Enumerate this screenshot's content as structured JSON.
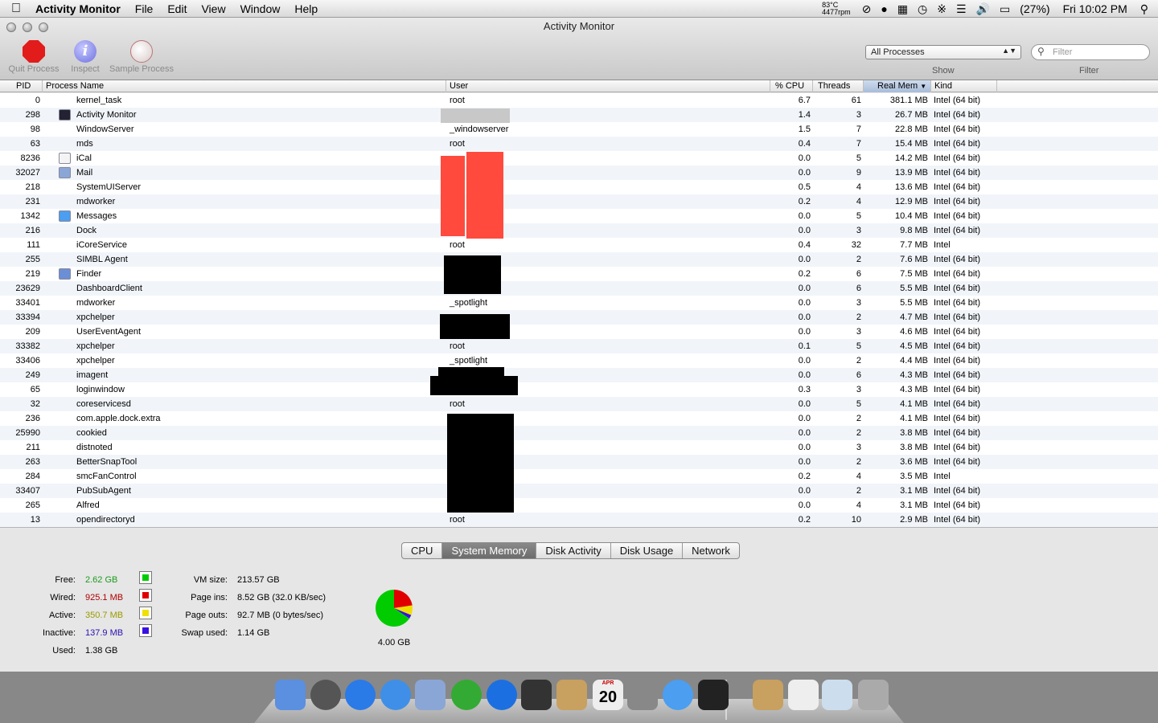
{
  "menubar": {
    "app_name": "Activity Monitor",
    "menus": [
      "File",
      "Edit",
      "View",
      "Window",
      "Help"
    ],
    "temp": "83°C",
    "rpm": "4477rpm",
    "battery": "(27%)",
    "clock": "Fri 10:02 PM"
  },
  "window": {
    "title": "Activity Monitor"
  },
  "toolbar": {
    "quit_label": "Quit Process",
    "inspect_label": "Inspect",
    "inspect_glyph": "i",
    "sample_label": "Sample Process",
    "show_value": "All Processes",
    "show_label": "Show",
    "filter_placeholder": "Filter",
    "filter_label": "Filter"
  },
  "columns": {
    "pid": "PID",
    "name": "Process Name",
    "user": "User",
    "cpu": "% CPU",
    "threads": "Threads",
    "mem": "Real Mem",
    "kind": "Kind"
  },
  "processes": [
    {
      "pid": "0",
      "name": "kernel_task",
      "user": "root",
      "cpu": "6.7",
      "threads": "61",
      "mem": "381.1 MB",
      "kind": "Intel (64 bit)",
      "icon": ""
    },
    {
      "pid": "298",
      "name": "Activity Monitor",
      "user": "",
      "cpu": "1.4",
      "threads": "3",
      "mem": "26.7 MB",
      "kind": "Intel (64 bit)",
      "icon": "activity-monitor-icon"
    },
    {
      "pid": "98",
      "name": "WindowServer",
      "user": "_windowserver",
      "cpu": "1.5",
      "threads": "7",
      "mem": "22.8 MB",
      "kind": "Intel (64 bit)",
      "icon": ""
    },
    {
      "pid": "63",
      "name": "mds",
      "user": "root",
      "cpu": "0.4",
      "threads": "7",
      "mem": "15.4 MB",
      "kind": "Intel (64 bit)",
      "icon": ""
    },
    {
      "pid": "8236",
      "name": "iCal",
      "user": "",
      "cpu": "0.0",
      "threads": "5",
      "mem": "14.2 MB",
      "kind": "Intel (64 bit)",
      "icon": "ical-icon"
    },
    {
      "pid": "32027",
      "name": "Mail",
      "user": "",
      "cpu": "0.0",
      "threads": "9",
      "mem": "13.9 MB",
      "kind": "Intel (64 bit)",
      "icon": "mail-icon"
    },
    {
      "pid": "218",
      "name": "SystemUIServer",
      "user": "",
      "cpu": "0.5",
      "threads": "4",
      "mem": "13.6 MB",
      "kind": "Intel (64 bit)",
      "icon": ""
    },
    {
      "pid": "231",
      "name": "mdworker",
      "user": "",
      "cpu": "0.2",
      "threads": "4",
      "mem": "12.9 MB",
      "kind": "Intel (64 bit)",
      "icon": ""
    },
    {
      "pid": "1342",
      "name": "Messages",
      "user": "",
      "cpu": "0.0",
      "threads": "5",
      "mem": "10.4 MB",
      "kind": "Intel (64 bit)",
      "icon": "messages-icon"
    },
    {
      "pid": "216",
      "name": "Dock",
      "user": "",
      "cpu": "0.0",
      "threads": "3",
      "mem": "9.8 MB",
      "kind": "Intel (64 bit)",
      "icon": ""
    },
    {
      "pid": "111",
      "name": "iCoreService",
      "user": "root",
      "cpu": "0.4",
      "threads": "32",
      "mem": "7.7 MB",
      "kind": "Intel",
      "icon": ""
    },
    {
      "pid": "255",
      "name": "SIMBL Agent",
      "user": "",
      "cpu": "0.0",
      "threads": "2",
      "mem": "7.6 MB",
      "kind": "Intel (64 bit)",
      "icon": ""
    },
    {
      "pid": "219",
      "name": "Finder",
      "user": "",
      "cpu": "0.2",
      "threads": "6",
      "mem": "7.5 MB",
      "kind": "Intel (64 bit)",
      "icon": "finder-icon"
    },
    {
      "pid": "23629",
      "name": "DashboardClient",
      "user": "",
      "cpu": "0.0",
      "threads": "6",
      "mem": "5.5 MB",
      "kind": "Intel (64 bit)",
      "icon": ""
    },
    {
      "pid": "33401",
      "name": "mdworker",
      "user": "_spotlight",
      "cpu": "0.0",
      "threads": "3",
      "mem": "5.5 MB",
      "kind": "Intel (64 bit)",
      "icon": ""
    },
    {
      "pid": "33394",
      "name": "xpchelper",
      "user": "",
      "cpu": "0.0",
      "threads": "2",
      "mem": "4.7 MB",
      "kind": "Intel (64 bit)",
      "icon": ""
    },
    {
      "pid": "209",
      "name": "UserEventAgent",
      "user": "",
      "cpu": "0.0",
      "threads": "3",
      "mem": "4.6 MB",
      "kind": "Intel (64 bit)",
      "icon": ""
    },
    {
      "pid": "33382",
      "name": "xpchelper",
      "user": "root",
      "cpu": "0.1",
      "threads": "5",
      "mem": "4.5 MB",
      "kind": "Intel (64 bit)",
      "icon": ""
    },
    {
      "pid": "33406",
      "name": "xpchelper",
      "user": "_spotlight",
      "cpu": "0.0",
      "threads": "2",
      "mem": "4.4 MB",
      "kind": "Intel (64 bit)",
      "icon": ""
    },
    {
      "pid": "249",
      "name": "imagent",
      "user": "",
      "cpu": "0.0",
      "threads": "6",
      "mem": "4.3 MB",
      "kind": "Intel (64 bit)",
      "icon": ""
    },
    {
      "pid": "65",
      "name": "loginwindow",
      "user": "",
      "cpu": "0.3",
      "threads": "3",
      "mem": "4.3 MB",
      "kind": "Intel (64 bit)",
      "icon": ""
    },
    {
      "pid": "32",
      "name": "coreservicesd",
      "user": "root",
      "cpu": "0.0",
      "threads": "5",
      "mem": "4.1 MB",
      "kind": "Intel (64 bit)",
      "icon": ""
    },
    {
      "pid": "236",
      "name": "com.apple.dock.extra",
      "user": "",
      "cpu": "0.0",
      "threads": "2",
      "mem": "4.1 MB",
      "kind": "Intel (64 bit)",
      "icon": ""
    },
    {
      "pid": "25990",
      "name": "cookied",
      "user": "",
      "cpu": "0.0",
      "threads": "2",
      "mem": "3.8 MB",
      "kind": "Intel (64 bit)",
      "icon": ""
    },
    {
      "pid": "211",
      "name": "distnoted",
      "user": "",
      "cpu": "0.0",
      "threads": "3",
      "mem": "3.8 MB",
      "kind": "Intel (64 bit)",
      "icon": ""
    },
    {
      "pid": "263",
      "name": "BetterSnapTool",
      "user": "",
      "cpu": "0.0",
      "threads": "2",
      "mem": "3.6 MB",
      "kind": "Intel (64 bit)",
      "icon": ""
    },
    {
      "pid": "284",
      "name": "smcFanControl",
      "user": "",
      "cpu": "0.2",
      "threads": "4",
      "mem": "3.5 MB",
      "kind": "Intel",
      "icon": ""
    },
    {
      "pid": "33407",
      "name": "PubSubAgent",
      "user": "",
      "cpu": "0.0",
      "threads": "2",
      "mem": "3.1 MB",
      "kind": "Intel (64 bit)",
      "icon": ""
    },
    {
      "pid": "265",
      "name": "Alfred",
      "user": "",
      "cpu": "0.0",
      "threads": "4",
      "mem": "3.1 MB",
      "kind": "Intel (64 bit)",
      "icon": ""
    },
    {
      "pid": "13",
      "name": "opendirectoryd",
      "user": "root",
      "cpu": "0.2",
      "threads": "10",
      "mem": "2.9 MB",
      "kind": "Intel (64 bit)",
      "icon": ""
    }
  ],
  "tabs": [
    "CPU",
    "System Memory",
    "Disk Activity",
    "Disk Usage",
    "Network"
  ],
  "active_tab": "System Memory",
  "memory": {
    "free_label": "Free:",
    "free": "2.62 GB",
    "free_color": "#00cc00",
    "wired_label": "Wired:",
    "wired": "925.1 MB",
    "wired_color": "#e00000",
    "active_label": "Active:",
    "active": "350.7 MB",
    "active_color": "#f0e000",
    "inactive_label": "Inactive:",
    "inactive": "137.9 MB",
    "inactive_color": "#3a10e0",
    "used_label": "Used:",
    "used": "1.38 GB",
    "vm_label": "VM size:",
    "vm": "213.57 GB",
    "pageins_label": "Page ins:",
    "pageins": "8.52 GB (32.0 KB/sec)",
    "pageouts_label": "Page outs:",
    "pageouts": "92.7 MB (0 bytes/sec)",
    "swap_label": "Swap used:",
    "swap": "1.14 GB",
    "total": "4.00 GB"
  },
  "dock": [
    "finder-icon",
    "launchpad-icon",
    "app-store-icon",
    "safari-icon",
    "mail-icon",
    "spotify-icon",
    "itunes-icon",
    "facetime-icon",
    "contacts-icon",
    "calendar-icon",
    "system-preferences-icon",
    "messages-icon",
    "activity-monitor-icon",
    "documents-stack-icon",
    "applications-stack-icon",
    "downloads-stack-icon",
    "trash-icon"
  ],
  "dock_calendar_day": "20",
  "dock_calendar_month": "APR"
}
